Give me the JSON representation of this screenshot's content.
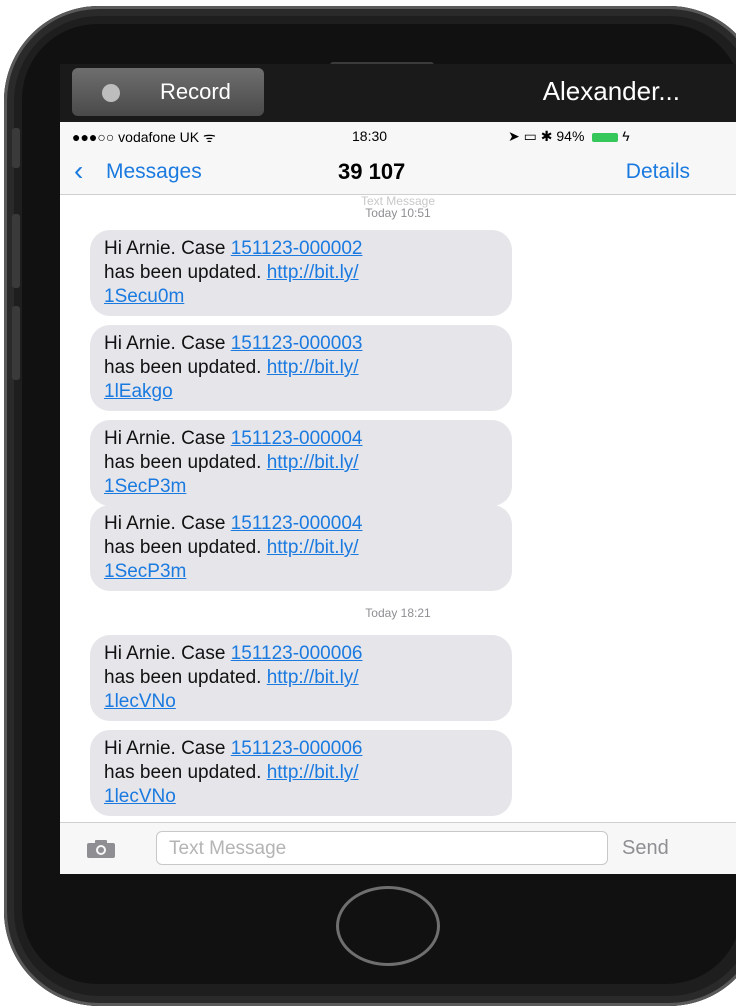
{
  "recording": {
    "record_label": "Record",
    "contact_name": "Alexander..."
  },
  "status_bar": {
    "carrier": "●●●○○ vodafone UK",
    "time": "18:30",
    "battery": "94%"
  },
  "nav": {
    "back_label": "Messages",
    "title": "39 107",
    "details": "Details"
  },
  "conversation": {
    "header_label": "Text Message",
    "header_time": "Today 10:51",
    "messages": [
      {
        "prefix": "Hi Arnie. Case ",
        "case": "151123-000002",
        "middle": "has been updated. ",
        "url1": "http://bit.ly/",
        "url2": "1Secu0m"
      },
      {
        "prefix": "Hi Arnie. Case ",
        "case": "151123-000003",
        "middle": "has been updated. ",
        "url1": "http://bit.ly/",
        "url2": "1lEakgo"
      },
      {
        "prefix": "Hi Arnie. Case ",
        "case": "151123-000004",
        "middle": "has been updated. ",
        "url1": "http://bit.ly/",
        "url2": "1SecP3m"
      },
      {
        "prefix": "Hi Arnie. Case ",
        "case": "151123-000004",
        "middle": "has been updated. ",
        "url1": "http://bit.ly/",
        "url2": "1SecP3m"
      },
      {
        "prefix": "Hi Arnie. Case ",
        "case": "151123-000006",
        "middle": "has been updated. ",
        "url1": "http://bit.ly/",
        "url2": "1lecVNo"
      },
      {
        "prefix": "Hi Arnie. Case ",
        "case": "151123-000006",
        "middle": "has been updated. ",
        "url1": "http://bit.ly/",
        "url2": "1lecVNo"
      }
    ],
    "second_time": "Today 18:21"
  },
  "composer": {
    "placeholder": "Text Message",
    "send_label": "Send"
  },
  "colors": {
    "accent": "#1a7ae0",
    "bubble": "#e5e5ea",
    "battery": "#35c759"
  }
}
